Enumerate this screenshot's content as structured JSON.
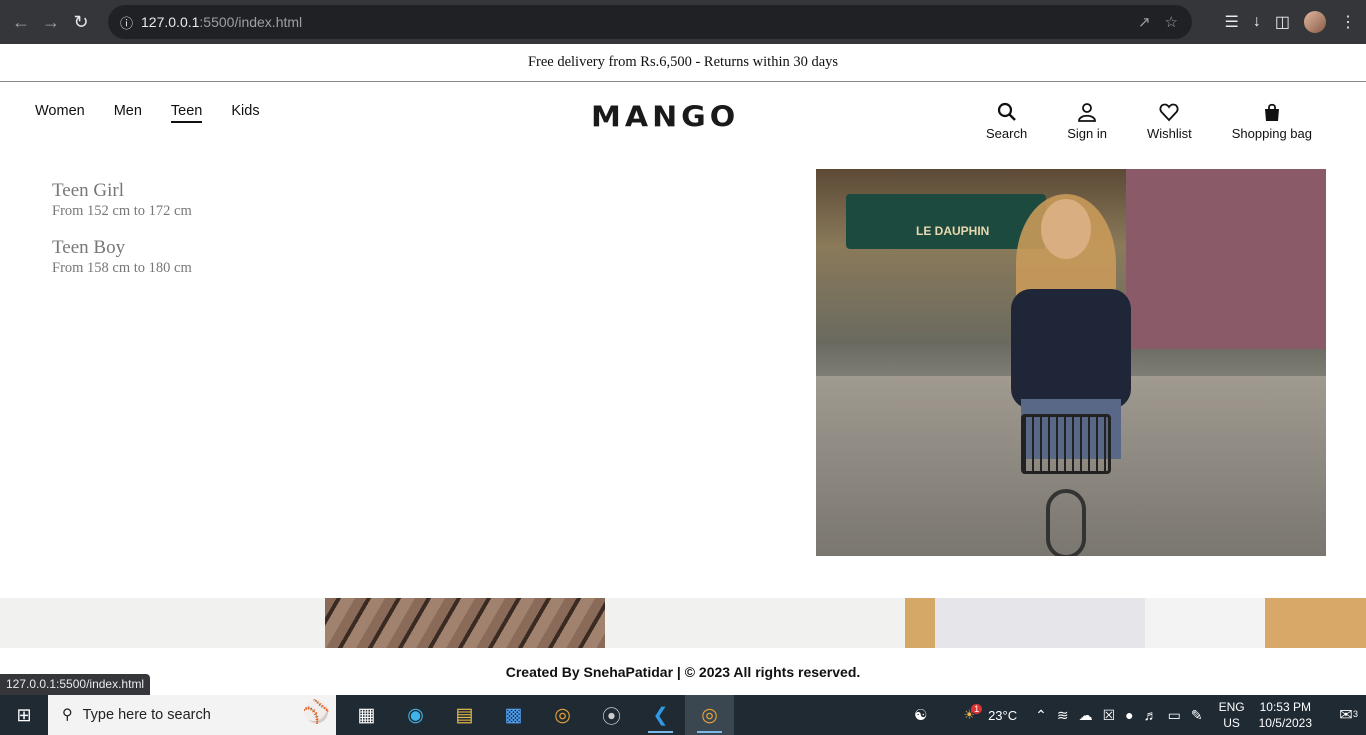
{
  "browser": {
    "url_host": "127.0.0.1",
    "url_rest": ":5500/index.html",
    "status_url": "127.0.0.1:5500/index.html"
  },
  "banner": {
    "text": "Free delivery from Rs.6,500 - Returns within 30 days"
  },
  "nav": {
    "items": [
      "Women",
      "Men",
      "Teen",
      "Kids"
    ],
    "active": "Teen"
  },
  "logo": "MANGO",
  "actions": {
    "search": "Search",
    "signin": "Sign in",
    "wishlist": "Wishlist",
    "bag": "Shopping bag"
  },
  "menu": {
    "items": [
      {
        "title": "Teen Girl",
        "sub": "From 152 cm to 172 cm"
      },
      {
        "title": "Teen Boy",
        "sub": "From 158 cm to 180 cm"
      }
    ]
  },
  "hero": {
    "sign_text": "LE DAUPHIN"
  },
  "footer": {
    "text": "Created By  SnehaPatidar | © 2023 All rights reserved."
  },
  "taskbar": {
    "search_placeholder": "Type here to search",
    "weather": "23°C",
    "weather_badge": "1",
    "lang_top": "ENG",
    "lang_bottom": "US",
    "time": "10:53 PM",
    "date": "10/5/2023",
    "notif_count": "3"
  },
  "colors": {
    "chrome_bg": "#35363a",
    "taskbar_bg": "#1f2a33",
    "menu_text": "#777777"
  }
}
